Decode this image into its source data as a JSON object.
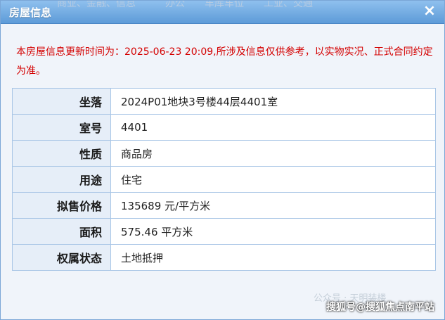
{
  "dialog": {
    "title": "房屋信息",
    "background_tabs": "商业、金融、信息　　　办公　　车库车位　　工业、交通",
    "close_icon": "×"
  },
  "notice": "本房屋信息更新时间为：2025-06-23 20:09,所涉及信息仅供参考，以实物实况、正式合同约定为准。",
  "rows": [
    {
      "label": "坐落",
      "value": "2024P01地块3号楼44层4401室"
    },
    {
      "label": "室号",
      "value": "4401"
    },
    {
      "label": "性质",
      "value": "商品房"
    },
    {
      "label": "用途",
      "value": "住宅"
    },
    {
      "label": "拟售价格",
      "value": "135689 元/平方米"
    },
    {
      "label": "面积",
      "value": "575.46 平方米"
    },
    {
      "label": "权属状态",
      "value": "土地抵押"
    }
  ],
  "watermark_faint": "公众号 · 天明装楼",
  "watermark": "搜狐号@搜狐焦点南平站",
  "colors": {
    "title_bar": "#5d9bd8",
    "notice_text": "#d40000",
    "label_bg": "#e6eef8",
    "border": "#a9c6e6"
  }
}
